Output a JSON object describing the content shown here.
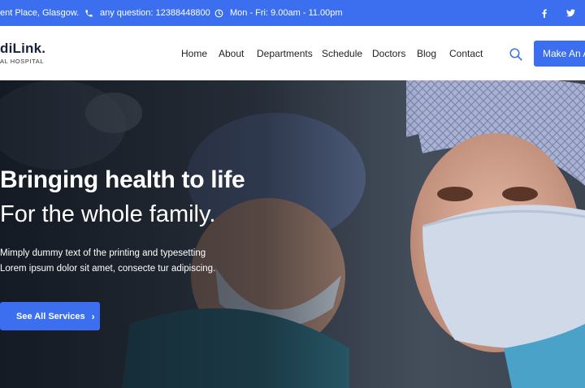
{
  "topbar": {
    "address": "ent Place, Glasgow.",
    "phone": "any question: 12388448800",
    "hours": "Mon - Fri:   9.00am - 11.00pm",
    "social": {
      "facebook": "f",
      "twitter": "twitter-icon"
    }
  },
  "header": {
    "logo_name": "diLink.",
    "logo_sub": "AL HOSPITAL",
    "nav": [
      "Home",
      "About",
      "Departments",
      "Schedule",
      "Doctors",
      "Blog",
      "Contact"
    ],
    "appointment_label": "Make An Ap"
  },
  "hero": {
    "title": "Bringing health to life",
    "subtitle": "For the whole family.",
    "line1": "Mimply dummy text of the printing and typesetting",
    "line2": "Lorem ipsum dolor sit amet, consecte tur adipiscing.",
    "cta_label": "See All Services",
    "cta_arrow": "›"
  },
  "colors": {
    "accent": "#3b6ff0",
    "logo": "#15233f"
  },
  "icons": [
    "phone-icon",
    "clock-icon",
    "facebook-icon",
    "twitter-icon",
    "search-icon",
    "chevron-right-icon"
  ]
}
